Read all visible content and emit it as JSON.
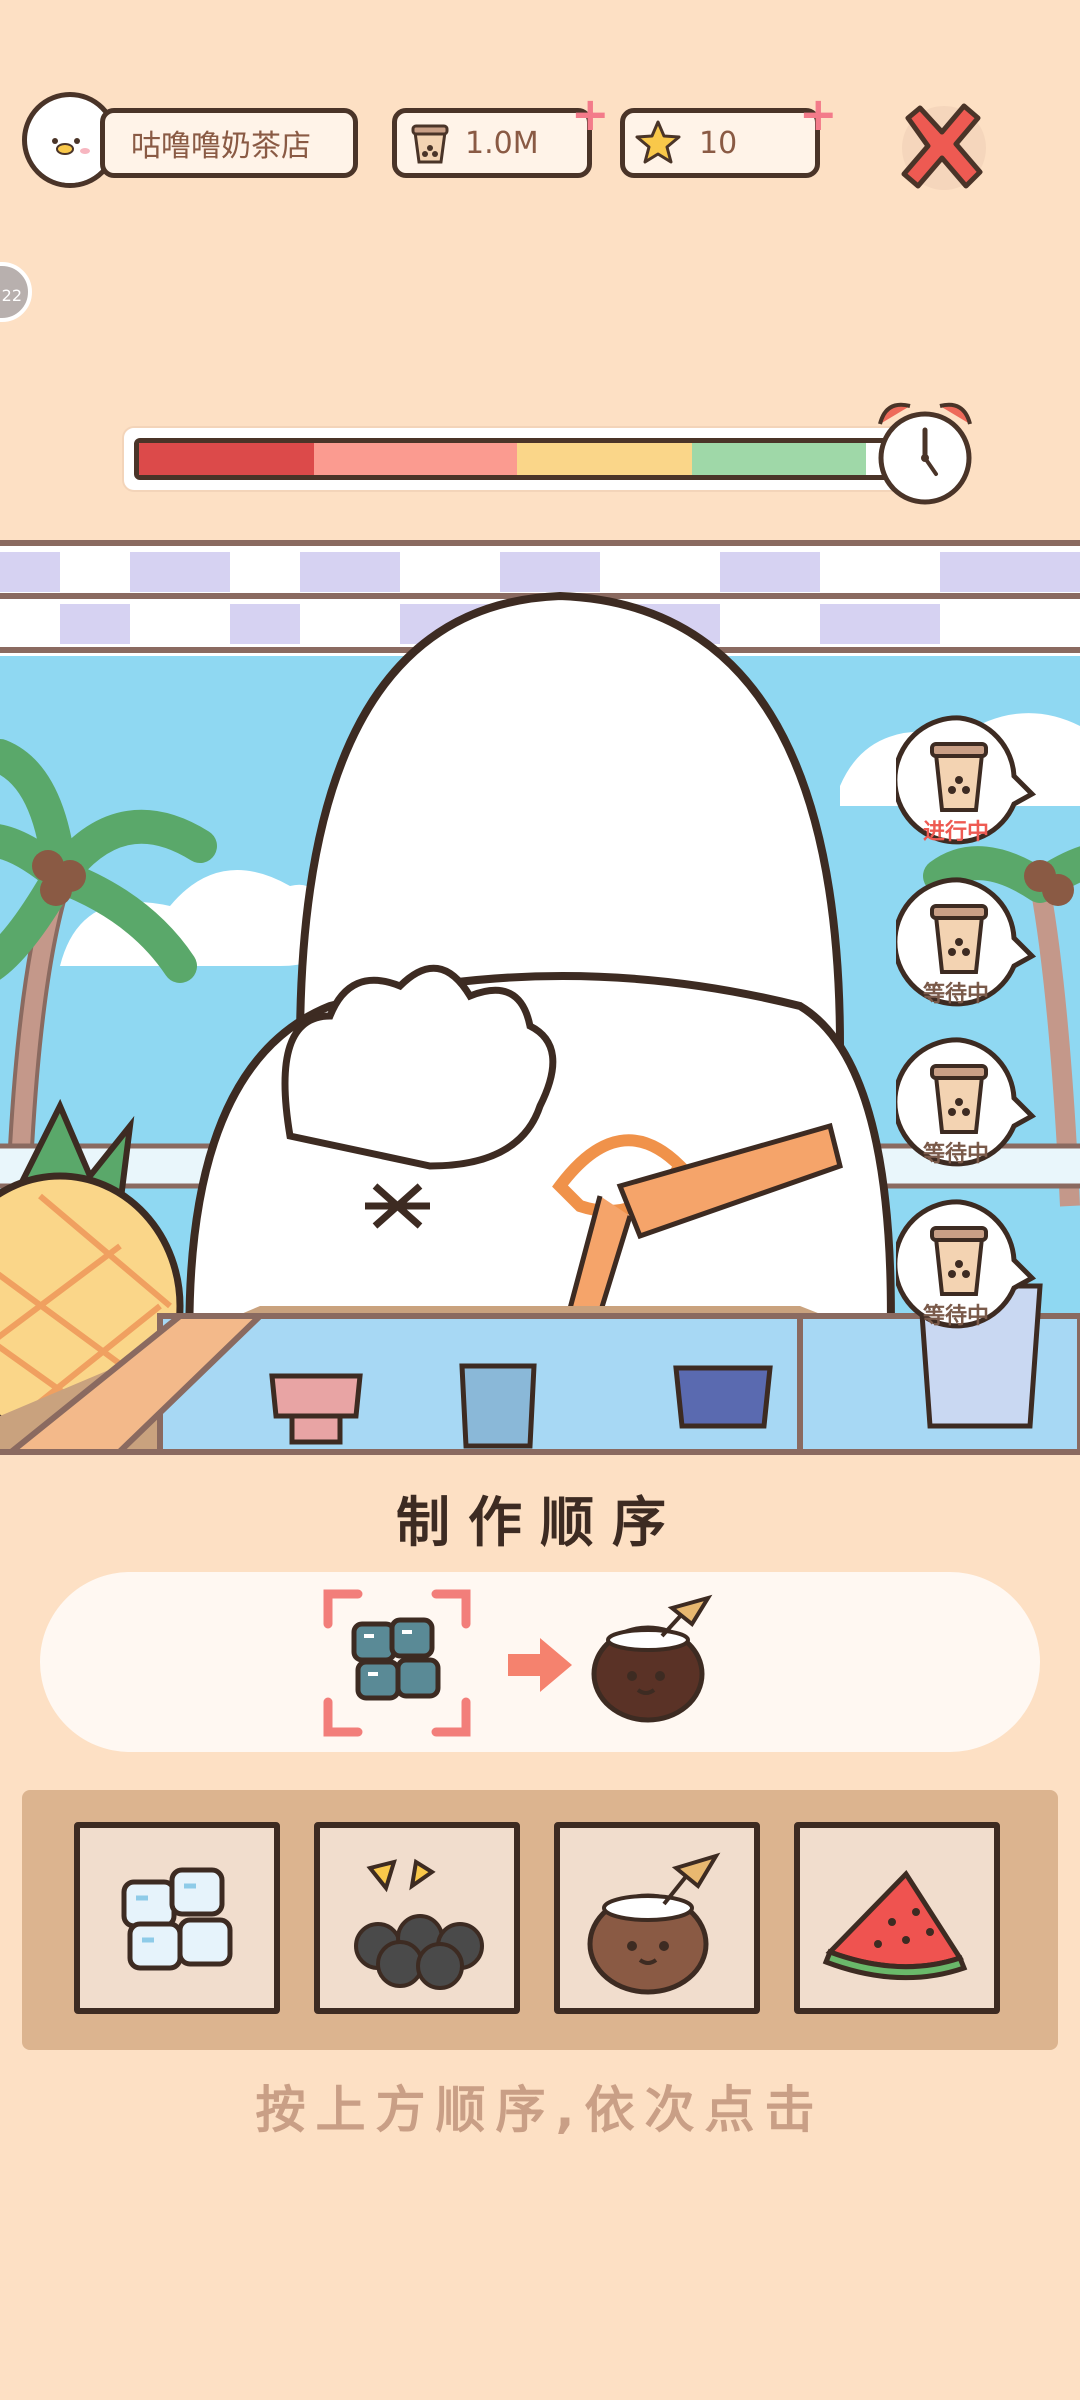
{
  "hud": {
    "shop_name": "咕噜噜奶茶店",
    "currency": "1.0M",
    "stars": "10",
    "side_badge": "22"
  },
  "timer": {
    "segments": [
      "#dc4a4a",
      "#fb9b90",
      "#fad689",
      "#9fd8a8"
    ],
    "remaining_fraction": 0.97
  },
  "orders": [
    {
      "status": "进行中",
      "color": "#ee5a52"
    },
    {
      "status": "等待中",
      "color": "#7a5a4a"
    },
    {
      "status": "等待中",
      "color": "#7a5a4a"
    },
    {
      "status": "等待中",
      "color": "#7a5a4a"
    }
  ],
  "recipe": {
    "title": "制作顺序",
    "steps": [
      "ice-icon",
      "coconut-icon"
    ],
    "current_step": 0
  },
  "ingredients": [
    {
      "name": "ice-icon"
    },
    {
      "name": "tapioca-pearls-icon"
    },
    {
      "name": "coconut-icon"
    },
    {
      "name": "watermelon-icon"
    }
  ],
  "hint": "按上方顺序,依次点击"
}
